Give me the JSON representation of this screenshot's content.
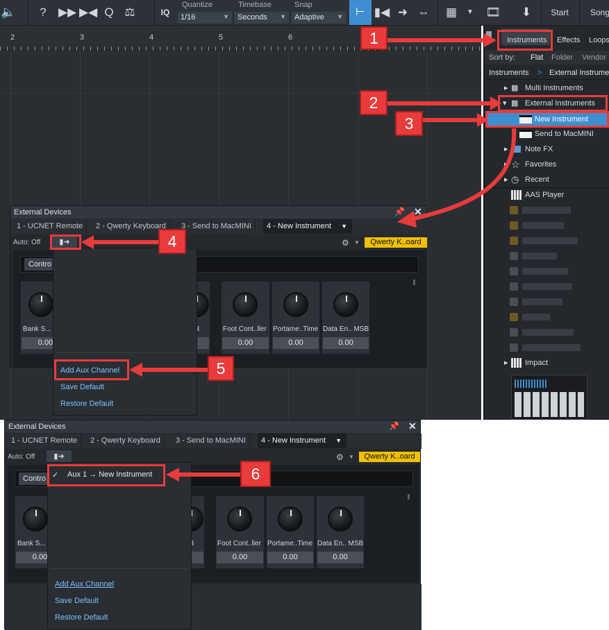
{
  "toolbar": {
    "iq_label": "IQ",
    "quantize_label": "Quantize",
    "quantize_value": "1/16",
    "timebase_label": "Timebase",
    "timebase_value": "Seconds",
    "snap_label": "Snap",
    "snap_value": "Adaptive",
    "start_label": "Start",
    "song_label": "Song"
  },
  "ruler": {
    "marks": [
      "2",
      "3",
      "4",
      "5",
      "6"
    ]
  },
  "browser": {
    "tabs": [
      "Instruments",
      "Effects",
      "Loops"
    ],
    "sort_label": "Sort by:",
    "sort_options": [
      "Flat",
      "Folder",
      "Vendor"
    ],
    "breadcrumb_root": "Instruments",
    "breadcrumb_current": "External Instrume",
    "items": [
      {
        "label": "Multi Instruments"
      },
      {
        "label": "External Instruments"
      },
      {
        "label": "New Instrument"
      },
      {
        "label": "Send to MacMINI"
      },
      {
        "label": "Note FX"
      },
      {
        "label": "Favorites"
      },
      {
        "label": "Recent"
      },
      {
        "label": "AAS Player"
      },
      {
        "label": "Impact"
      }
    ]
  },
  "panel_top": {
    "title": "External Devices",
    "tabs": [
      "1 - UCNET Remote",
      "2 - Qwerty Keyboard",
      "3 - Send to MacMINI",
      "4 - New Instrument"
    ],
    "auto_label": "Auto: Off",
    "device_label": "Qwerty K..oard",
    "control_label": "Contro",
    "knobs": [
      {
        "label": "Bank S...",
        "value": "0.00"
      },
      {
        "label": "ol 3",
        "value": "0"
      },
      {
        "label": "Foot Cont..ller",
        "value": "0.00"
      },
      {
        "label": "Portame..Time",
        "value": "0.00"
      },
      {
        "label": "Data En.. MSB",
        "value": "0.00"
      }
    ],
    "menu": [
      "Add Aux Channel",
      "Save Default",
      "Restore Default"
    ]
  },
  "panel_bottom": {
    "title": "External Devices",
    "tabs": [
      "1 - UCNET Remote",
      "2 - Qwerty Keyboard",
      "3 - Send to MacMINI",
      "4 - New Instrument"
    ],
    "auto_label": "Auto: Off",
    "device_label": "Qwerty K..oard",
    "control_label": "Contro",
    "aux_item": "Aux 1 → New Instrument",
    "knobs": [
      {
        "label": "Bank S...",
        "value": "0.00"
      },
      {
        "label": "ol 3",
        "value": "0"
      },
      {
        "label": "Foot Cont..ller",
        "value": "0.00"
      },
      {
        "label": "Portame..Time",
        "value": "0.00"
      },
      {
        "label": "Data En.. MSB",
        "value": "0.00"
      }
    ],
    "menu": [
      "Add Aux Channel",
      "Save Default",
      "Restore Default"
    ]
  },
  "callouts": [
    "1",
    "2",
    "3",
    "4",
    "5",
    "6"
  ],
  "colors": {
    "accent_red": "#e93b3b",
    "selection_blue": "#3f8fd0",
    "device_yellow": "#f0c000",
    "menu_link": "#7fc1ff"
  }
}
